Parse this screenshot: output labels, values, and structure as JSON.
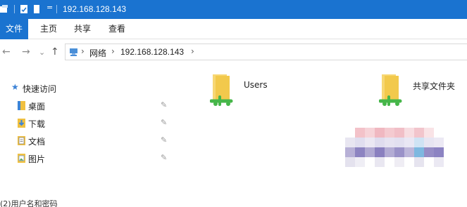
{
  "window": {
    "title": "192.168.128.143"
  },
  "ribbon": {
    "tabs": [
      "文件",
      "主页",
      "共享",
      "查看"
    ]
  },
  "address": {
    "crumbs": [
      "网络",
      "192.168.128.143"
    ]
  },
  "sidebar": {
    "quick_access": "快速访问",
    "items": [
      {
        "label": "桌面",
        "icon": "desktop-folder-icon"
      },
      {
        "label": "下载",
        "icon": "download-folder-icon"
      },
      {
        "label": "文档",
        "icon": "document-folder-icon"
      },
      {
        "label": "图片",
        "icon": "pictures-folder-icon"
      }
    ]
  },
  "content": {
    "shares": [
      {
        "label": "Users",
        "icon": "network-share-folder-icon"
      },
      {
        "label": "共享文件夹",
        "icon": "network-share-folder-icon"
      }
    ]
  },
  "caption": "(2)用户名和密码",
  "colors": {
    "accent": "#1a73d0",
    "folder": "#f2c94c",
    "network": "#46b649"
  }
}
